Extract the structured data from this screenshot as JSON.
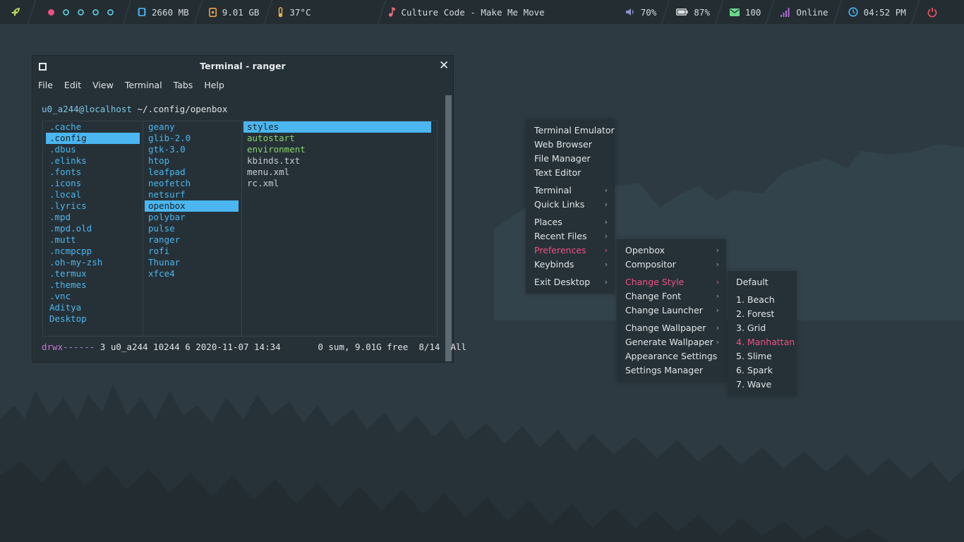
{
  "topbar": {
    "launcher_icon": "rocket-icon",
    "workspaces": [
      {
        "state": "active"
      },
      {
        "state": "inactive"
      },
      {
        "state": "inactive"
      },
      {
        "state": "inactive"
      },
      {
        "state": "inactive"
      }
    ],
    "memory": {
      "icon": "memory-chip-icon",
      "value": "2660 MB"
    },
    "disk": {
      "icon": "disk-icon",
      "value": "9.01 GB"
    },
    "temperature": {
      "icon": "thermometer-icon",
      "value": "37°C"
    },
    "now_playing": {
      "icon": "music-note-icon",
      "value": "Culture Code - Make Me Move"
    },
    "volume": {
      "icon": "speaker-icon",
      "value": "70%"
    },
    "battery": {
      "icon": "battery-icon",
      "value": "87%"
    },
    "mail": {
      "icon": "mail-icon",
      "value": "100"
    },
    "network": {
      "icon": "signal-bars-icon",
      "value": "Online"
    },
    "clock": {
      "icon": "clock-icon",
      "value": "04:52 PM"
    },
    "power_icon": "power-icon",
    "colors": {
      "bar": "#232d32",
      "accent_pink": "#ee4f84",
      "accent_cyan": "#56b7c8",
      "purple": "#b06bd6",
      "blue": "#4bb6f0",
      "orange": "#f0a04b",
      "green": "#6bd68a"
    }
  },
  "terminal": {
    "title": "Terminal - ranger",
    "menu": [
      "File",
      "Edit",
      "View",
      "Terminal",
      "Tabs",
      "Help"
    ],
    "prompt_user": "u0_a244@localhost",
    "prompt_path": "~/.config/openbox",
    "column1": [
      {
        "name": ".cache",
        "type": "dir"
      },
      {
        "name": ".config",
        "type": "sel"
      },
      {
        "name": ".dbus",
        "type": "dir"
      },
      {
        "name": ".elinks",
        "type": "dir"
      },
      {
        "name": ".fonts",
        "type": "dir"
      },
      {
        "name": ".icons",
        "type": "dir"
      },
      {
        "name": ".local",
        "type": "dir"
      },
      {
        "name": ".lyrics",
        "type": "dir"
      },
      {
        "name": ".mpd",
        "type": "dir"
      },
      {
        "name": ".mpd.old",
        "type": "dir"
      },
      {
        "name": ".mutt",
        "type": "dir"
      },
      {
        "name": ".ncmpcpp",
        "type": "dir"
      },
      {
        "name": ".oh-my-zsh",
        "type": "dir"
      },
      {
        "name": ".termux",
        "type": "dir"
      },
      {
        "name": ".themes",
        "type": "dir"
      },
      {
        "name": ".vnc",
        "type": "dir"
      },
      {
        "name": "Aditya",
        "type": "dir"
      },
      {
        "name": "Desktop",
        "type": "dir"
      }
    ],
    "column2": [
      {
        "name": "geany",
        "type": "dir"
      },
      {
        "name": "glib-2.0",
        "type": "dir"
      },
      {
        "name": "gtk-3.0",
        "type": "dir"
      },
      {
        "name": "htop",
        "type": "dir"
      },
      {
        "name": "leafpad",
        "type": "dir"
      },
      {
        "name": "neofetch",
        "type": "dir"
      },
      {
        "name": "netsurf",
        "type": "dir"
      },
      {
        "name": "openbox",
        "type": "sel"
      },
      {
        "name": "polybar",
        "type": "dir"
      },
      {
        "name": "pulse",
        "type": "dir"
      },
      {
        "name": "ranger",
        "type": "dir"
      },
      {
        "name": "rofi",
        "type": "dir"
      },
      {
        "name": "Thunar",
        "type": "dir"
      },
      {
        "name": "xfce4",
        "type": "dir"
      }
    ],
    "column3": [
      {
        "name": "styles",
        "type": "sel"
      },
      {
        "name": "autostart",
        "type": "exe"
      },
      {
        "name": "environment",
        "type": "exe"
      },
      {
        "name": "kbinds.txt",
        "type": "file"
      },
      {
        "name": "menu.xml",
        "type": "file"
      },
      {
        "name": "rc.xml",
        "type": "file"
      }
    ],
    "status_perm": "drwx------",
    "status_rest": " 3 u0_a244 10244 6 2020-11-07 14:34       0 sum, 9.01G free  8/14  All"
  },
  "root_menu": {
    "items": [
      {
        "label": "Terminal Emulator",
        "sub": false
      },
      {
        "label": "Web Browser",
        "sub": false
      },
      {
        "label": "File Manager",
        "sub": false
      },
      {
        "label": "Text Editor",
        "sub": false
      },
      {
        "sep": true
      },
      {
        "label": "Terminal",
        "sub": true
      },
      {
        "label": "Quick Links",
        "sub": true
      },
      {
        "sep": true
      },
      {
        "label": "Places",
        "sub": true
      },
      {
        "label": "Recent Files",
        "sub": true
      },
      {
        "label": "Preferences",
        "sub": true,
        "active": true
      },
      {
        "label": "Keybinds",
        "sub": true
      },
      {
        "sep": true
      },
      {
        "label": "Exit Desktop",
        "sub": true
      }
    ]
  },
  "preferences_menu": {
    "items": [
      {
        "label": "Openbox",
        "sub": true
      },
      {
        "label": "Compositor",
        "sub": true
      },
      {
        "sep": true
      },
      {
        "label": "Change Style",
        "sub": true,
        "active": true
      },
      {
        "label": "Change Font",
        "sub": true
      },
      {
        "label": "Change Launcher",
        "sub": true
      },
      {
        "sep": true
      },
      {
        "label": "Change Wallpaper",
        "sub": true
      },
      {
        "label": "Generate Wallpaper",
        "sub": true
      },
      {
        "label": "Appearance Settings",
        "sub": false
      },
      {
        "label": "Settings Manager",
        "sub": false
      }
    ]
  },
  "style_menu": {
    "items": [
      {
        "label": "Default",
        "sub": false
      },
      {
        "sep": true
      },
      {
        "label": "1. Beach",
        "sub": false
      },
      {
        "label": "2. Forest",
        "sub": false
      },
      {
        "label": "3. Grid",
        "sub": false
      },
      {
        "label": "4. Manhattan",
        "sub": false,
        "active": true
      },
      {
        "label": "5. Slime",
        "sub": false
      },
      {
        "label": "6. Spark",
        "sub": false
      },
      {
        "label": "7. Wave",
        "sub": false
      }
    ]
  },
  "submenu_arrow": "›"
}
